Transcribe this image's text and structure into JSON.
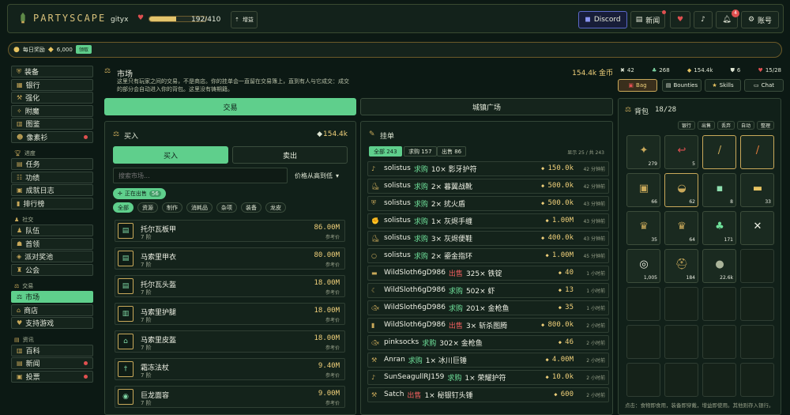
{
  "header": {
    "logo": "PARTYSCAPE",
    "username": "gityx",
    "hp_text": "192/410",
    "hp_fraction": 0.47,
    "boost_label": "增益",
    "discord_label": "Discord",
    "news_label": "新闻",
    "notif_count": "4",
    "account_label": "账号"
  },
  "daily": {
    "label": "每日奖励",
    "amount": "6,000",
    "claim": "领取"
  },
  "sidebar": {
    "items1": [
      "装备",
      "银行",
      "强化",
      "附魔",
      "图鉴",
      "像素衫"
    ],
    "sec2": "进度",
    "items2": [
      "任务",
      "功绩",
      "成就日志",
      "排行榜"
    ],
    "sec3": "社交",
    "items3": [
      "队伍",
      "首领",
      "派对奖池",
      "公会"
    ],
    "sec4": "交易",
    "items4": [
      "市场",
      "商店",
      "支持游戏"
    ],
    "sec5": "资讯",
    "items5": [
      "百科",
      "新闻",
      "投票"
    ]
  },
  "market": {
    "title": "市场",
    "desc1": "这里只有玩家之间的交易，不是商店。你的挂单会一直留在交易簿上，直到有人与它成交：成交",
    "desc2": "的部分会自动进入你的背包。这里没有铸期籍。",
    "gold": "154.4k 金币",
    "tab_trade": "交易",
    "tab_plaza": "城镇广场"
  },
  "buy": {
    "title": "买入",
    "gold": "154.4k",
    "btn_buy": "买入",
    "btn_sell": "卖出",
    "search_placeholder": "搜索市场...",
    "sort": "价格从高到低",
    "onsale": "正在出售",
    "onsale_count": "56",
    "filters": [
      "全部",
      "资源",
      "制作",
      "消耗品",
      "杂项",
      "装备",
      "龙皮"
    ],
    "items": [
      {
        "name": "托尔瓦板甲",
        "tier": "7 阶",
        "price": "86.00M",
        "ref": "参考价"
      },
      {
        "name": "马索里甲衣",
        "tier": "7 阶",
        "price": "80.00M",
        "ref": "参考价"
      },
      {
        "name": "托尔瓦头盔",
        "tier": "7 阶",
        "price": "18.00M",
        "ref": "参考价"
      },
      {
        "name": "马索里护腿",
        "tier": "7 阶",
        "price": "18.00M",
        "ref": "参考价"
      },
      {
        "name": "马索里皮盔",
        "tier": "7 阶",
        "price": "18.00M",
        "ref": "参考价"
      },
      {
        "name": "霜冻法杖",
        "tier": "7 阶",
        "price": "9.40M",
        "ref": "参考价"
      },
      {
        "name": "巨龙面容",
        "tier": "7 阶",
        "price": "9.00M",
        "ref": "参考价"
      }
    ]
  },
  "orders": {
    "title": "挂单",
    "tab_all": "全部 243",
    "tab_buy": "求购 157",
    "tab_sell": "出售 86",
    "shown": "显示 25 / 共 243",
    "rows": [
      {
        "user": "solistus",
        "type": "求购",
        "item": "10× 影牙护符",
        "price": "150.0k",
        "time": "42 分钟前"
      },
      {
        "user": "solistus",
        "type": "求购",
        "item": "2× 暮翼战靴",
        "price": "500.0k",
        "time": "42 分钟前"
      },
      {
        "user": "solistus",
        "type": "求购",
        "item": "2× 扰火盾",
        "price": "500.0k",
        "time": "43 分钟前"
      },
      {
        "user": "solistus",
        "type": "求购",
        "item": "1× 灰烬手缠",
        "price": "1.00M",
        "time": "43 分钟前"
      },
      {
        "user": "solistus",
        "type": "求购",
        "item": "3× 灰烬便鞋",
        "price": "400.0k",
        "time": "43 分钟前"
      },
      {
        "user": "solistus",
        "type": "求购",
        "item": "2× 鎏金指环",
        "price": "1.00M",
        "time": "45 分钟前"
      },
      {
        "user": "WildSloth6gD986",
        "type": "出售",
        "item": "325× 铁锭",
        "price": "40",
        "time": "1 小时前"
      },
      {
        "user": "WildSloth6gD986",
        "type": "求购",
        "item": "502× 虾",
        "price": "13",
        "time": "1 小时前"
      },
      {
        "user": "WildSloth6gD986",
        "type": "求购",
        "item": "201× 金枪鱼",
        "price": "35",
        "time": "1 小时前"
      },
      {
        "user": "WildSloth6gD986",
        "type": "出售",
        "item": "3× 斩杀图腾",
        "price": "800.0k",
        "time": "2 小时前"
      },
      {
        "user": "pinksocks",
        "type": "求购",
        "item": "302× 金枪鱼",
        "price": "46",
        "time": "2 小时前"
      },
      {
        "user": "Anran",
        "type": "求购",
        "item": "1× 冰川巨锤",
        "price": "4.00M",
        "time": "2 小时前"
      },
      {
        "user": "SunSeagullRJ159",
        "type": "求购",
        "item": "1× 荣耀护符",
        "price": "10.0k",
        "time": "2 小时前"
      },
      {
        "user": "Satch",
        "type": "出售",
        "item": "1× 秘银钉头锤",
        "price": "600",
        "time": "2 小时前"
      }
    ]
  },
  "stats": [
    "42",
    "268",
    "154.4k",
    "6",
    "15/28"
  ],
  "right": {
    "tab_bag": "Bag",
    "tab_bounties": "Bounties",
    "tab_skills": "Skills",
    "tab_chat": "Chat",
    "bag_title": "背包",
    "bag_count": "18/28",
    "actions": [
      "银行",
      "出售",
      "丢弃",
      "自动",
      "整理"
    ],
    "slots": [
      "279",
      "5",
      "",
      "",
      "66",
      "62",
      "8",
      "33",
      "35",
      "64",
      "171",
      "",
      "1,005",
      "184",
      "22.6k"
    ],
    "footer": "点击：食物即食用，装备即穿戴，增益即使用。其他则存入银行。"
  }
}
